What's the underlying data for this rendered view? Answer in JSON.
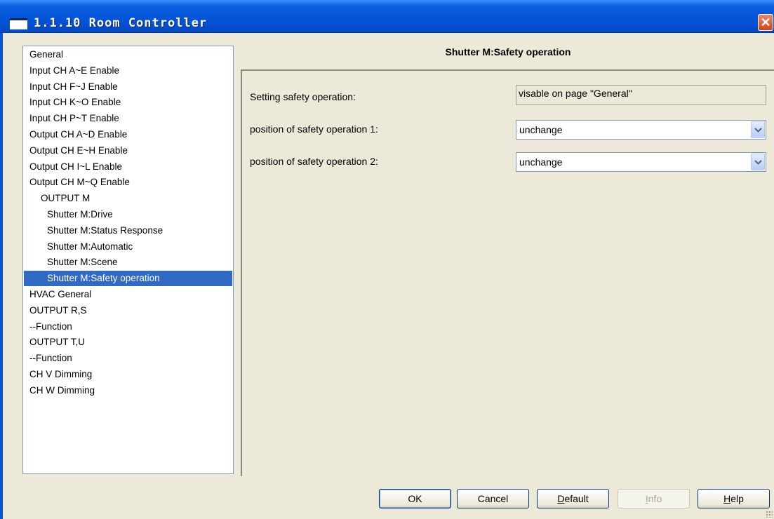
{
  "window": {
    "title": "1.1.10 Room Controller",
    "close_glyph": "✕"
  },
  "nav": {
    "items": [
      {
        "label": "General",
        "indent": 0,
        "selected": false
      },
      {
        "label": "Input CH A~E Enable",
        "indent": 0,
        "selected": false
      },
      {
        "label": "Input CH F~J Enable",
        "indent": 0,
        "selected": false
      },
      {
        "label": "Input CH K~O Enable",
        "indent": 0,
        "selected": false
      },
      {
        "label": "Input CH P~T Enable",
        "indent": 0,
        "selected": false
      },
      {
        "label": "Output CH A~D Enable",
        "indent": 0,
        "selected": false
      },
      {
        "label": "Output CH E~H Enable",
        "indent": 0,
        "selected": false
      },
      {
        "label": "Output CH I~L Enable",
        "indent": 0,
        "selected": false
      },
      {
        "label": "Output CH M~Q Enable",
        "indent": 0,
        "selected": false
      },
      {
        "label": "OUTPUT M",
        "indent": 1,
        "selected": false
      },
      {
        "label": "Shutter M:Drive",
        "indent": 2,
        "selected": false
      },
      {
        "label": "Shutter M:Status Response",
        "indent": 2,
        "selected": false
      },
      {
        "label": "Shutter M:Automatic",
        "indent": 2,
        "selected": false
      },
      {
        "label": "Shutter M:Scene",
        "indent": 2,
        "selected": false
      },
      {
        "label": "Shutter M:Safety operation",
        "indent": 2,
        "selected": true
      },
      {
        "label": "HVAC General",
        "indent": 0,
        "selected": false
      },
      {
        "label": "OUTPUT R,S",
        "indent": 0,
        "selected": false
      },
      {
        "label": "--Function",
        "indent": 0,
        "selected": false
      },
      {
        "label": "OUTPUT T,U",
        "indent": 0,
        "selected": false
      },
      {
        "label": "--Function",
        "indent": 0,
        "selected": false
      },
      {
        "label": "CH V Dimming",
        "indent": 0,
        "selected": false
      },
      {
        "label": "CH W Dimming",
        "indent": 0,
        "selected": false
      }
    ]
  },
  "page": {
    "title": "Shutter M:Safety operation",
    "params": [
      {
        "label": "Setting safety operation:",
        "value": "visable on page \"General\""
      },
      {
        "label": "position of safety operation 1:",
        "value": "unchange"
      },
      {
        "label": "position of safety operation 2:",
        "value": "unchange"
      }
    ]
  },
  "buttons": {
    "ok": "OK",
    "cancel": "Cancel",
    "default_prefix": "D",
    "default_rest": "efault",
    "info_prefix": "I",
    "info_rest": "nfo",
    "help_prefix": "H",
    "help_rest": "elp"
  },
  "colors": {
    "selection": "#316ac5",
    "titlebar": "#0454d8",
    "dialog_bg": "#ece9d8"
  }
}
